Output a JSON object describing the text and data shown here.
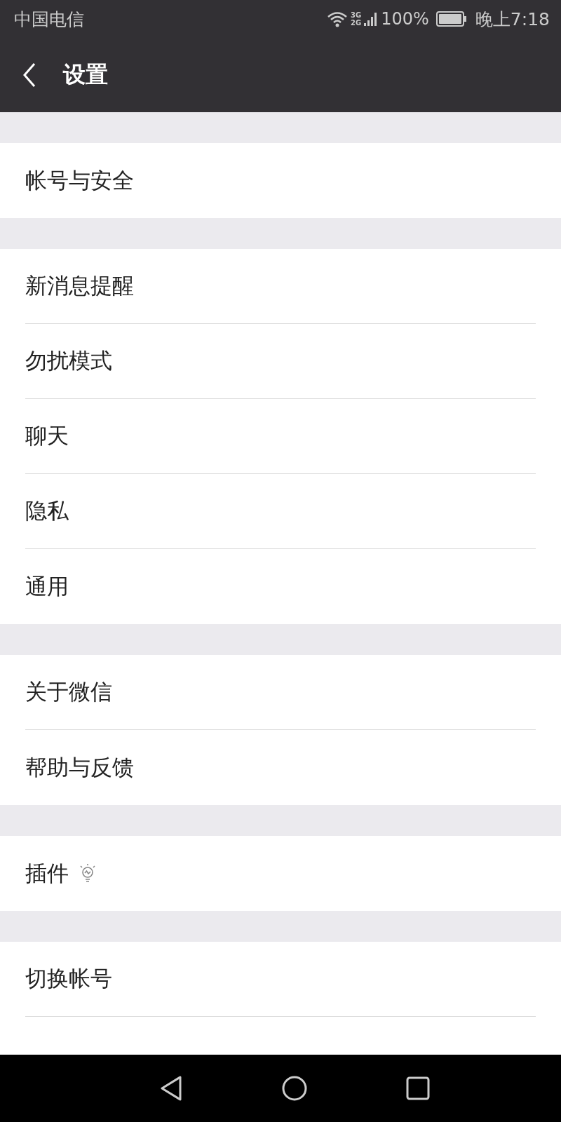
{
  "status_bar": {
    "carrier": "中国电信",
    "network_top": "3G",
    "network_bottom": "2G",
    "battery": "100%",
    "time": "晚上7:18"
  },
  "header": {
    "title": "设置"
  },
  "groups": [
    {
      "items": [
        {
          "label": "帐号与安全",
          "kind": "plain"
        }
      ]
    },
    {
      "items": [
        {
          "label": "新消息提醒",
          "kind": "plain"
        },
        {
          "label": "勿扰模式",
          "kind": "plain"
        },
        {
          "label": "聊天",
          "kind": "plain"
        },
        {
          "label": "隐私",
          "kind": "plain"
        },
        {
          "label": "通用",
          "kind": "plain"
        }
      ]
    },
    {
      "items": [
        {
          "label": "关于微信",
          "kind": "plain"
        },
        {
          "label": "帮助与反馈",
          "kind": "plain"
        }
      ]
    },
    {
      "items": [
        {
          "label": "插件",
          "kind": "with_icon"
        }
      ]
    },
    {
      "items": [
        {
          "label": "切换帐号",
          "kind": "plain"
        }
      ]
    }
  ]
}
